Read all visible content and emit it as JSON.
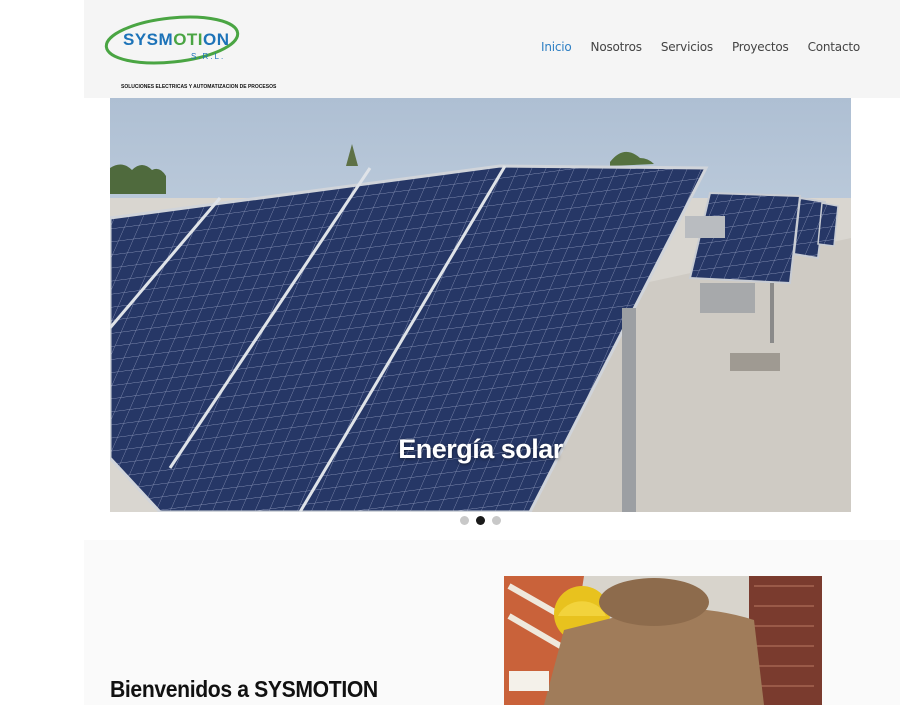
{
  "brand": {
    "name_prefix": "SYSM",
    "name_accent": "OTI",
    "name_suffix": "ON",
    "suffix": "S.R.L.",
    "tagline": "SOLUCIONES ELECTRICAS Y AUTOMATIZACION DE PROCESOS"
  },
  "nav": {
    "items": [
      {
        "label": "Inicio",
        "active": true
      },
      {
        "label": "Nosotros"
      },
      {
        "label": "Servicios"
      },
      {
        "label": "Proyectos"
      },
      {
        "label": "Contacto"
      }
    ]
  },
  "slider": {
    "caption": "Energía solar",
    "slide_count": 3,
    "active_index": 1
  },
  "welcome": {
    "title": "Bienvenidos a SYSMOTION"
  },
  "colors": {
    "brand_blue": "#1d73b8",
    "brand_green": "#4aa543",
    "nav_active": "#2e7fc4"
  }
}
